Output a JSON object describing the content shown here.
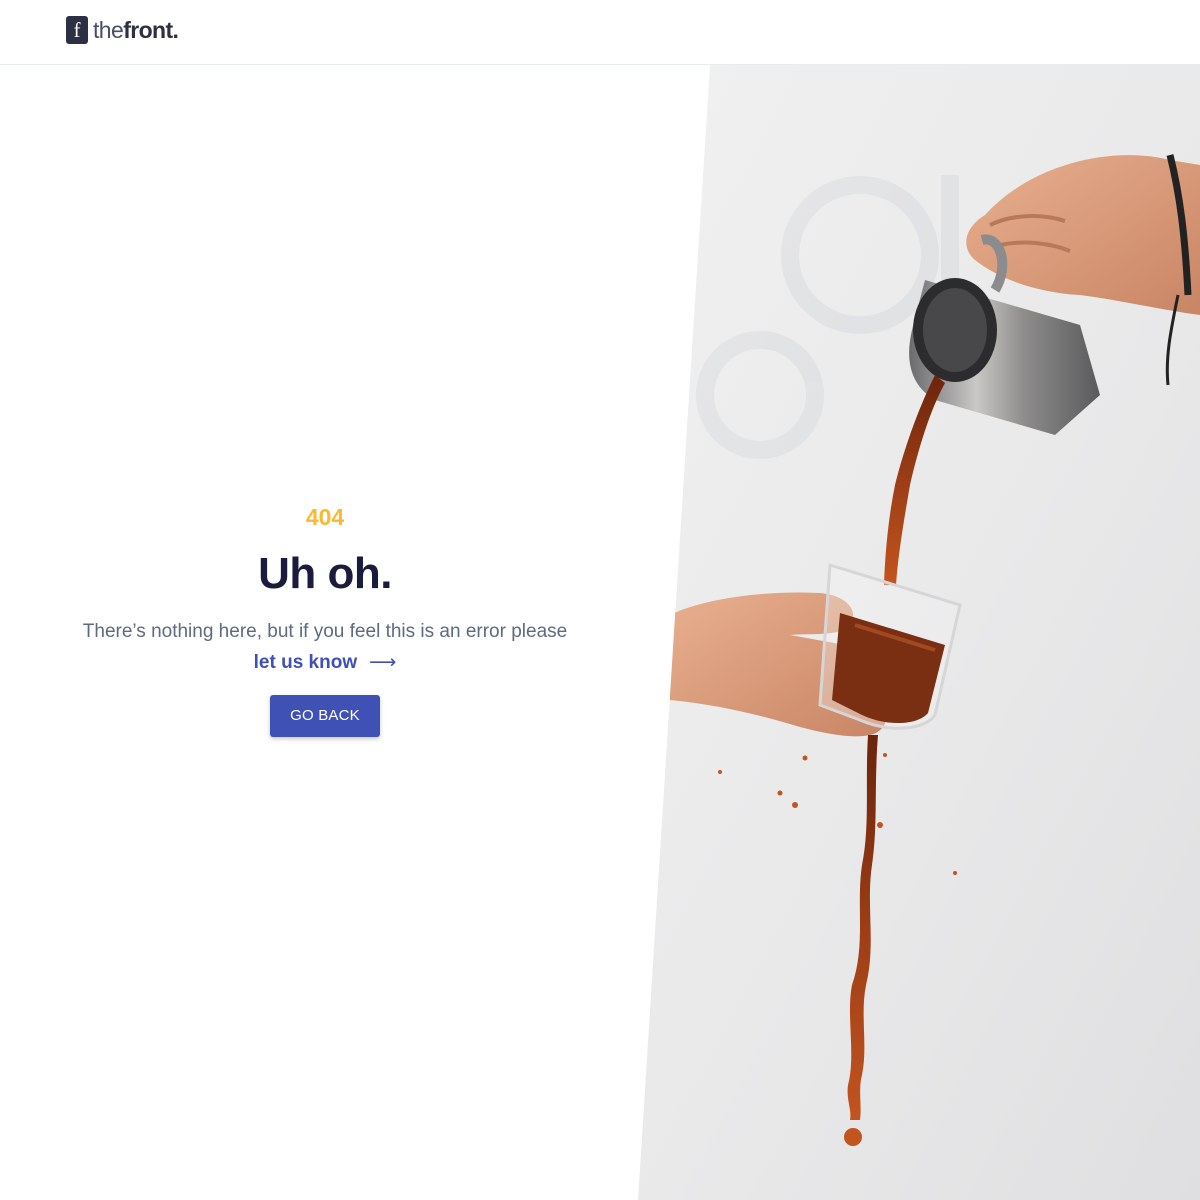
{
  "header": {
    "logo_mark": "f",
    "logo_text_light": "the",
    "logo_text_bold": "front."
  },
  "error": {
    "code": "404",
    "title": "Uh oh.",
    "message": "There’s nothing here, but if you feel this is an error please",
    "link_label": "let us know",
    "arrow_glyph": "⟶",
    "button_label": "GO BACK"
  },
  "colors": {
    "code": "#f9b934",
    "title": "#1a1b3d",
    "accent": "#3f51b5",
    "text": "#5e6a7e",
    "coffee": "#7a2e12"
  },
  "icons": {
    "logo": "thefront-logo-icon",
    "arrow": "arrow-right-icon",
    "photo": "coffee-pour-photo"
  }
}
